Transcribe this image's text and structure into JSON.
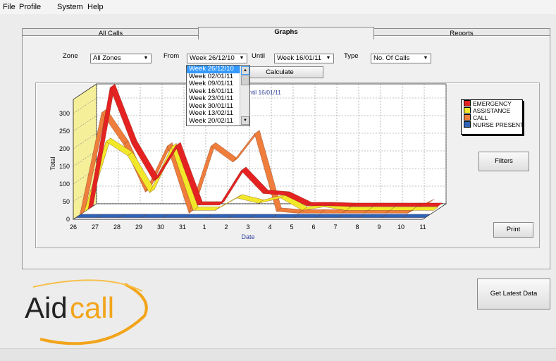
{
  "menu": [
    "File",
    "Profile",
    "System",
    "Help"
  ],
  "tabs": [
    "All Calls",
    "Graphs",
    "Reports"
  ],
  "filters": {
    "zone_label": "Zone",
    "zone_value": "All Zones",
    "from_label": "From",
    "from_value": "Week 26/12/10",
    "until_label": "Until",
    "until_value": "Week 16/01/11",
    "type_label": "Type",
    "type_value": "No. Of Calls"
  },
  "from_options": [
    "Week 26/12/10",
    "Week 02/01/11",
    "Week 09/01/11",
    "Week 16/01/11",
    "Week 23/01/11",
    "Week 30/01/11",
    "Week 13/02/11",
    "Week 20/02/11"
  ],
  "buttons": {
    "calculate": "Calculate",
    "filters": "Filters",
    "print": "Print",
    "get_latest": "Get Latest Data"
  },
  "logo_text": {
    "a": "Aid",
    "b": "call"
  },
  "colors": {
    "emergency": "#e52222",
    "assistance": "#f2e82a",
    "call": "#ef7d3c",
    "nurse": "#2e63b6",
    "wall": "#f5ef9a"
  },
  "chart_data": {
    "type": "line",
    "title_fragment": "0 Until 16/01/11",
    "xlabel": "Date",
    "ylabel": "Total",
    "categories": [
      "26",
      "27",
      "28",
      "29",
      "30",
      "31",
      "1",
      "2",
      "3",
      "4",
      "5",
      "6",
      "7",
      "8",
      "9",
      "10",
      "11"
    ],
    "yticks": [
      0,
      50,
      100,
      150,
      200,
      250,
      300
    ],
    "ylim": [
      0,
      340
    ],
    "series": [
      {
        "name": "EMERGENCY",
        "color": "#e52222",
        "values": [
          0,
          345,
          185,
          80,
          180,
          12,
          12,
          110,
          45,
          40,
          10,
          10,
          8,
          8,
          8,
          8,
          8
        ]
      },
      {
        "name": "ASSISTANCE",
        "color": "#f2e82a",
        "values": [
          0,
          200,
          160,
          55,
          185,
          5,
          5,
          40,
          25,
          40,
          5,
          15,
          5,
          5,
          5,
          5,
          5
        ]
      },
      {
        "name": "CALL",
        "color": "#ef7d3c",
        "values": [
          0,
          290,
          200,
          65,
          195,
          5,
          195,
          150,
          230,
          10,
          5,
          5,
          5,
          5,
          5,
          5,
          35
        ]
      },
      {
        "name": "NURSE PRESENT",
        "color": "#2e63b6",
        "values": [
          0,
          0,
          0,
          0,
          0,
          0,
          0,
          0,
          0,
          0,
          0,
          0,
          0,
          0,
          0,
          0,
          0
        ]
      }
    ]
  }
}
